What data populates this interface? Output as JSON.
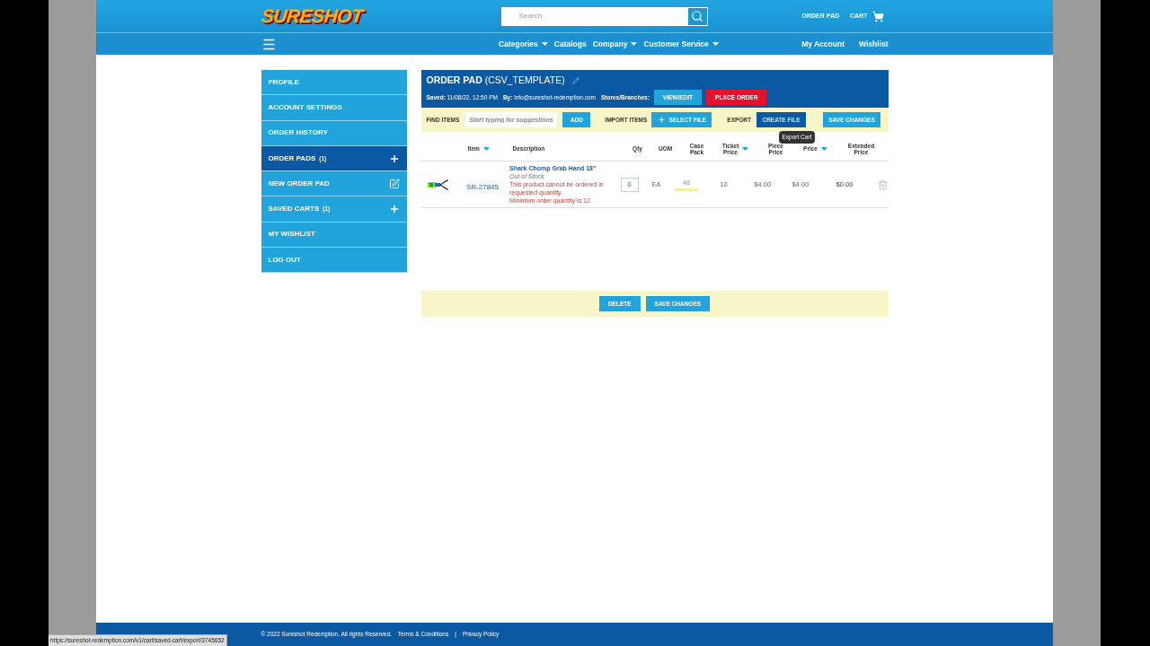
{
  "logo": {
    "text": "SURESHOT"
  },
  "search": {
    "placeholder": "Search"
  },
  "header_links": [
    "ORDER PAD",
    "CART"
  ],
  "nav": {
    "items": [
      {
        "label": "Categories",
        "dropdown": true
      },
      {
        "label": "Catalogs",
        "dropdown": false
      },
      {
        "label": "Company",
        "dropdown": true
      },
      {
        "label": "Customer Service",
        "dropdown": true
      }
    ],
    "account_links": [
      "My Account",
      "Wishlist"
    ]
  },
  "sidebar": {
    "items": [
      {
        "label": "PROFILE",
        "selected": false
      },
      {
        "label": "ACCOUNT SETTINGS",
        "selected": false
      },
      {
        "label": "ORDER HISTORY",
        "selected": false
      },
      {
        "label": "ORDER PADS",
        "count": "(1)",
        "kind": "expandable",
        "selected": true
      },
      {
        "label": "NEW ORDER PAD",
        "kind": "create",
        "selected": false
      },
      {
        "label": "SAVED CARTS",
        "count": "(1)",
        "kind": "expandable",
        "selected": false
      },
      {
        "label": "MY WISHLIST",
        "selected": false
      },
      {
        "label": "LOG OUT",
        "selected": false
      }
    ]
  },
  "order_pad": {
    "title": "ORDER PAD",
    "name": "(CSV_TEMPLATE)",
    "saved_label": "Saved:",
    "saved": "11/08/22, 12:50 PM",
    "by_label": "By:",
    "by": "info@sureshot-redemption.com",
    "stores_label": "Stores/Branches:",
    "buttons": [
      {
        "label": "VIEW/EDIT",
        "kind": "primary"
      },
      {
        "label": "PLACE ORDER",
        "kind": "danger"
      }
    ]
  },
  "toolbar": {
    "find_label": "FIND ITEMS",
    "find_placeholder": "Start typing for suggestions",
    "add": "ADD",
    "import_label": "IMPORT ITEMS",
    "select_file": "SELECT FILE",
    "export_label": "EXPORT",
    "create_file": "CREATE FILE",
    "save": "SAVE CHANGES",
    "tooltip": "Export Cart"
  },
  "table": {
    "columns": [
      {
        "lines": [
          "Item"
        ],
        "sortable": true
      },
      {
        "lines": [
          "Description"
        ],
        "sortable": false
      },
      {
        "lines": [
          "Qty"
        ],
        "sortable": false
      },
      {
        "lines": [
          "UOM"
        ],
        "sortable": false
      },
      {
        "lines": [
          "Case",
          "Pack"
        ],
        "sortable": false
      },
      {
        "lines": [
          "Ticket",
          "Price"
        ],
        "sortable": true
      },
      {
        "lines": [
          "Piece",
          "Price"
        ],
        "sortable": false
      },
      {
        "lines": [
          "Price"
        ],
        "sortable": true
      },
      {
        "lines": [
          "Extended",
          "Price"
        ],
        "sortable": false
      }
    ],
    "rows": [
      {
        "item": "SR-27845",
        "name": "Shark Chomp Grab Hand 18\"",
        "status": "Out of Stock",
        "errors": [
          "This product cannot be ordered in requested quantity.",
          "Minimum order quantity is 12."
        ],
        "qty": "0",
        "uom": "EA",
        "case_pack": "48",
        "ticket": "10",
        "piece": "$4.00",
        "unit": "$4.00",
        "extended": "$0.00"
      }
    ]
  },
  "footer_actions": [
    "DELETE",
    "SAVE CHANGES"
  ],
  "footer": {
    "copyright": "© 2022 Sureshot Redemption. All rights Reserved.",
    "links": [
      "Terms & Conditions",
      "Privacy Policy"
    ],
    "separator": "|"
  },
  "status_bar": "https://sureshot-redemption.com/v1/cart/saved-cart/export/3745652"
}
